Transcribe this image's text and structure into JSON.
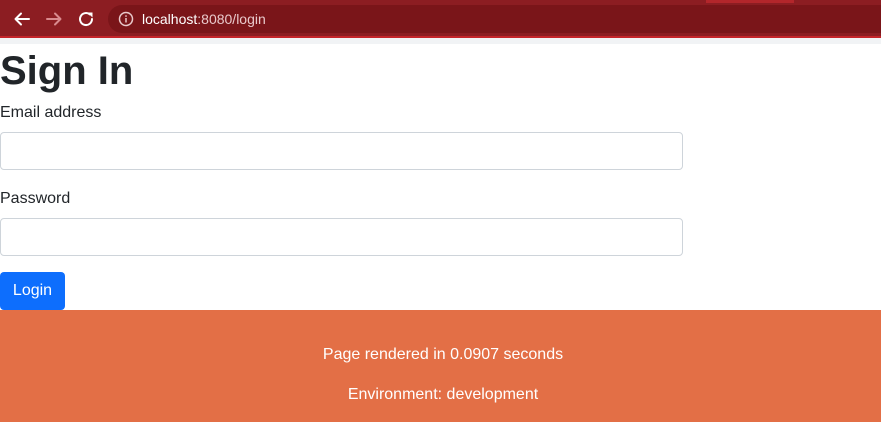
{
  "browser": {
    "url_host": "localhost",
    "url_rest": ":8080/login"
  },
  "page": {
    "title": "Sign In"
  },
  "form": {
    "email_label": "Email address",
    "email_value": "",
    "password_label": "Password",
    "password_value": "",
    "login_button": "Login"
  },
  "footer": {
    "render_time": "Page rendered in 0.0907 seconds",
    "environment": "Environment: development"
  },
  "colors": {
    "chrome": "#8c1d22",
    "primary_button": "#0d6efd",
    "footer": "#e36f46"
  }
}
